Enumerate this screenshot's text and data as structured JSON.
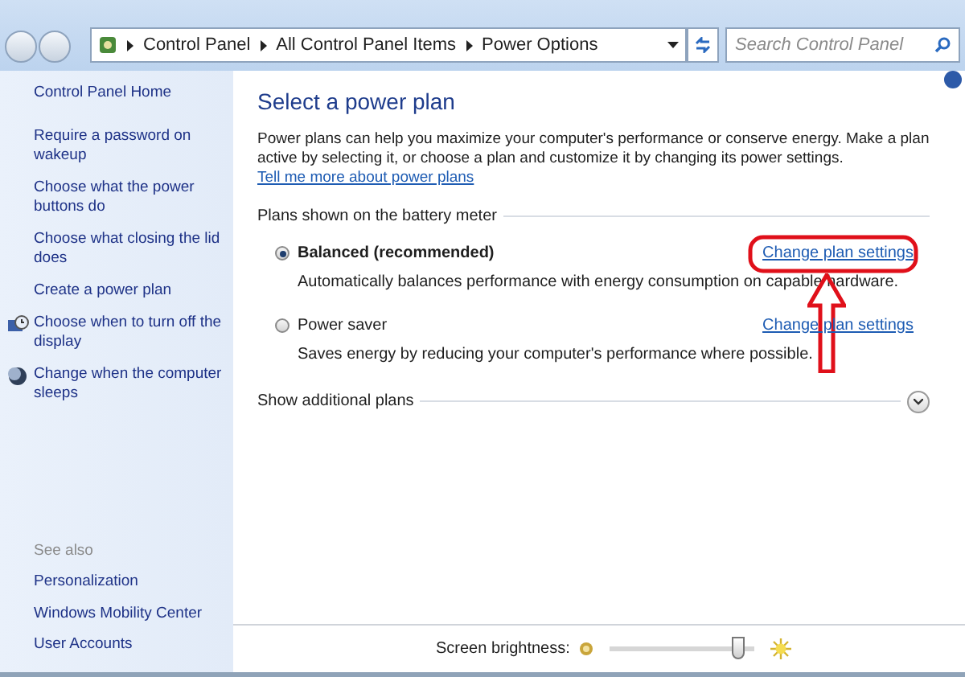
{
  "breadcrumb": [
    "Control Panel",
    "All Control Panel Items",
    "Power Options"
  ],
  "search": {
    "placeholder": "Search Control Panel"
  },
  "sidebar": {
    "home": "Control Panel Home",
    "items": [
      {
        "label": "Require a password on wakeup",
        "kind": "plain"
      },
      {
        "label": "Choose what the power buttons do",
        "kind": "plain"
      },
      {
        "label": "Choose what closing the lid does",
        "kind": "plain"
      },
      {
        "label": "Create a power plan",
        "kind": "plain"
      },
      {
        "label": "Choose when to turn off the display",
        "kind": "display"
      },
      {
        "label": "Change when the computer sleeps",
        "kind": "sleep"
      }
    ],
    "see_also_title": "See also",
    "see_also": [
      "Personalization",
      "Windows Mobility Center",
      "User Accounts"
    ]
  },
  "main": {
    "title": "Select a power plan",
    "intro": "Power plans can help you maximize your computer's performance or conserve energy. Make a plan active by selecting it, or choose a plan and customize it by changing its power settings.",
    "intro_link": "Tell me more about power plans",
    "group_title": "Plans shown on the battery meter",
    "plans": [
      {
        "name": "Balanced (recommended)",
        "selected": true,
        "description": "Automatically balances performance with energy consumption on capable hardware.",
        "link": "Change plan settings"
      },
      {
        "name": "Power saver",
        "selected": false,
        "description": "Saves energy by reducing your computer's performance where possible.",
        "link": "Change plan settings"
      }
    ],
    "more": "Show additional plans"
  },
  "brightness": {
    "label": "Screen brightness:",
    "level": 0.88
  }
}
